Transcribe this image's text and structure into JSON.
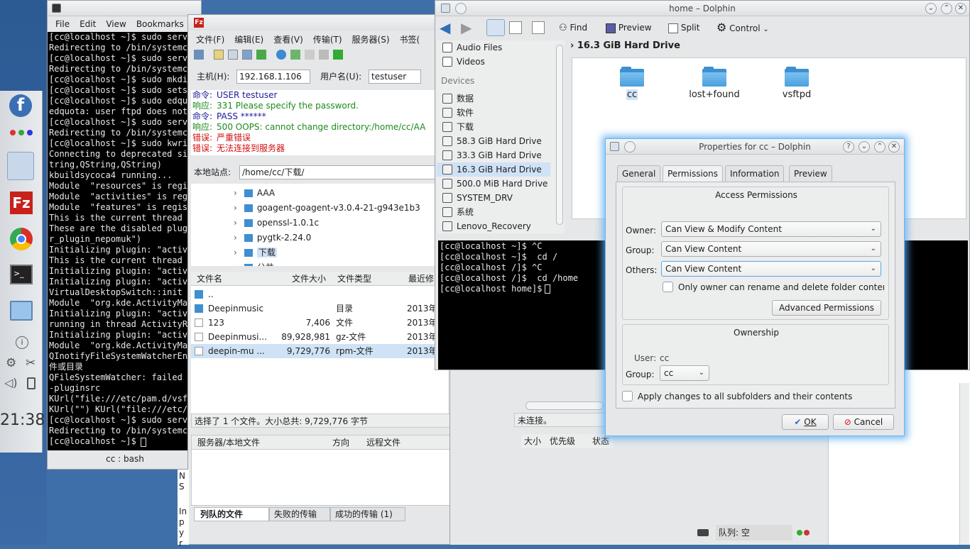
{
  "desktop": {
    "clock": "21:38"
  },
  "konsole": {
    "title": "cc : bash",
    "menu": [
      "File",
      "Edit",
      "View",
      "Bookmarks"
    ],
    "lines": [
      "[cc@localhost ~]$ sudo service vsftpd start",
      "Redirecting to /bin/systemctl start",
      "[cc@localhost ~]$ sudo service vsft",
      "Redirecting to /bin/systemctl resta",
      "[cc@localhost ~]$ sudo mkdir /var/",
      "[cc@localhost ~]$ sudo setsebool -",
      "[cc@localhost ~]$ sudo edquota ftpd",
      "edquota: user ftpd does not exist.",
      "[cc@localhost ~]$ sudo service vsft",
      "Redirecting to /bin/systemctl resta",
      "[cc@localhost ~]$ sudo kwrite /etc/",
      "Connecting to deprecated signal Q",
      "tring,QString,QString)",
      "kbuildsycoca4 running...",
      "Module  \"resources\" is registered",
      "Module  \"activities\" is registered",
      "Module  \"features\" is registered",
      "This is the current thread id for Ac",
      "These are the disabled plugins: (\"a",
      "r_plugin_nepomuk\")",
      "Initializing plugin: \"activitymanage",
      "This is the current thread id for Ac",
      "Initializing plugin: \"activitymanage",
      "Initializing plugin: \"activitymanage",
      "VirtualDesktopSwitch::init",
      "Module  \"org.kde.ActivityManager.",
      "Initializing plugin: \"activitymanage",
      "running in thread ActivityRanking",
      "Initializing plugin: \"activitymanage",
      "Module  \"org.kde.ActivityManager.",
      "QInotifyFileSystemWatcherEngine",
      "件或目录",
      "QFileSystemWatcher: failed to add",
      "-pluginsrc",
      "KUrl(\"file:///etc/pam.d/vsftpd\") KU",
      "KUrl(\"\") KUrl(\"file:///etc/pam.d/vsf",
      "[cc@localhost ~]$ sudo service vsft",
      "Redirecting to /bin/systemctl resta",
      "[cc@localhost ~]$ "
    ]
  },
  "filezilla": {
    "title": "",
    "menu": [
      "文件(F)",
      "编辑(E)",
      "查看(V)",
      "传输(T)",
      "服务器(S)",
      "书签("
    ],
    "host_label": "主机(H):",
    "host_value": "192.168.1.106",
    "user_label": "用户名(U):",
    "user_value": "testuser",
    "log": [
      {
        "k": "命令:",
        "v": "USER testuser",
        "c": "#1a1a9a"
      },
      {
        "k": "响应:",
        "v": "331 Please specify the password.",
        "c": "#1c8a1c"
      },
      {
        "k": "命令:",
        "v": "PASS ******",
        "c": "#1a1a9a"
      },
      {
        "k": "响应:",
        "v": "500 OOPS: cannot change directory:/home/cc/AA",
        "c": "#1c8a1c"
      },
      {
        "k": "错误:",
        "v": "严重错误",
        "c": "#d01010"
      },
      {
        "k": "错误:",
        "v": "无法连接到服务器",
        "c": "#d01010"
      }
    ],
    "local_label": "本地站点:",
    "local_path": "/home/cc/下载/",
    "tree": [
      "AAA",
      "goagent-goagent-v3.0.4-21-g943e1b3",
      "openssl-1.0.1c",
      "pygtk-2.24.0",
      "下载",
      "公共"
    ],
    "cols": [
      "文件名",
      "文件大小",
      "文件类型",
      "最近修"
    ],
    "files": [
      {
        "n": "..",
        "s": "",
        "t": "",
        "d": ""
      },
      {
        "n": "Deepinmusic",
        "s": "",
        "t": "目录",
        "d": "2013年"
      },
      {
        "n": "123",
        "s": "7,406",
        "t": "文件",
        "d": "2013年"
      },
      {
        "n": "Deepinmusi...",
        "s": "89,928,981",
        "t": "gz-文件",
        "d": "2013年"
      },
      {
        "n": "deepin-mu   ...",
        "s": "9,729,776",
        "t": "rpm-文件",
        "d": "2013年"
      }
    ],
    "local_status": "选择了 1 个文件。大小总共: 9,729,776 字节",
    "remote_status": "未连接。",
    "queue_cols": [
      "服务器/本地文件",
      "方向",
      "远程文件",
      "大小",
      "优先级",
      "状态"
    ],
    "queue_tabs": [
      "列队的文件",
      "失败的传输",
      "成功的传输 (1)"
    ],
    "queue_status": "队列: 空"
  },
  "dolphin": {
    "title": "home – Dolphin",
    "tools": [
      "Find",
      "Preview",
      "Split",
      "Control"
    ],
    "places": [
      "Audio Files",
      "Videos"
    ],
    "devices_header": "Devices",
    "devices": [
      "数据",
      "软件",
      "下载",
      "58.3 GiB Hard Drive",
      "33.3 GiB Hard Drive",
      "16.3 GiB Hard Drive",
      "500.0 MiB Hard Drive",
      "SYSTEM_DRV",
      "系统",
      "Lenovo_Recovery"
    ],
    "breadcrumb": "16.3 GiB Hard Drive",
    "folders": [
      "cc",
      "lost+found",
      "vsftpd"
    ],
    "terminal": [
      "[cc@localhost ~]$ ^C",
      "[cc@localhost ~]$  cd /",
      "[cc@localhost /]$ ^C",
      "[cc@localhost /]$  cd /home",
      "[cc@localhost home]$ "
    ]
  },
  "props": {
    "title": "Properties for cc – Dolphin",
    "tabs": [
      "General",
      "Permissions",
      "Information",
      "Preview"
    ],
    "access_title": "Access Permissions",
    "owner_label": "Owner:",
    "owner_value": "Can View & Modify Content",
    "group_label": "Group:",
    "group_value": "Can View Content",
    "others_label": "Others:",
    "others_value": "Can View Content",
    "only_owner": "Only owner can rename and delete folder conten",
    "advanced": "Advanced Permissions",
    "ownership_title": "Ownership",
    "user_label": "User:",
    "user_value": "cc",
    "group2_label": "Group:",
    "group2_value": "cc",
    "apply_sub": "Apply changes to all subfolders and their contents",
    "ok": "OK",
    "cancel": "Cancel"
  },
  "behind": {
    "n": "N",
    "s": "S",
    "i": "In",
    "p": "p",
    "y": "y",
    "r": "r"
  }
}
